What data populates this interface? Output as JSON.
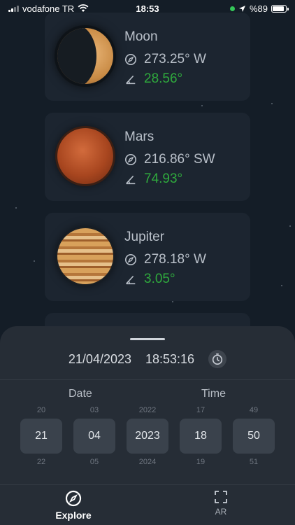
{
  "status_bar": {
    "carrier": "vodafone TR",
    "time": "18:53",
    "battery_percent": "%89",
    "battery_level": 0.89
  },
  "planets": [
    {
      "name": "Moon",
      "direction": "273.25° W",
      "altitude": "28.56°",
      "icon": "moon"
    },
    {
      "name": "Mars",
      "direction": "216.86° SW",
      "altitude": "74.93°",
      "icon": "mars"
    },
    {
      "name": "Jupiter",
      "direction": "278.18° W",
      "altitude": "3.05°",
      "icon": "jupiter"
    }
  ],
  "sheet": {
    "date": "21/04/2023",
    "time": "18:53:16",
    "date_header": "Date",
    "time_header": "Time",
    "pickers": [
      {
        "prev": "20",
        "value": "21",
        "next": "22"
      },
      {
        "prev": "03",
        "value": "04",
        "next": "05"
      },
      {
        "prev": "2022",
        "value": "2023",
        "next": "2024"
      },
      {
        "prev": "17",
        "value": "18",
        "next": "19"
      },
      {
        "prev": "49",
        "value": "50",
        "next": "51"
      }
    ]
  },
  "tabs": {
    "explore": "Explore",
    "ar": "AR"
  },
  "colors": {
    "background": "#141d27",
    "card": "#1c2530",
    "altitude_green": "#2faa3d",
    "sheet": "#262d36"
  }
}
